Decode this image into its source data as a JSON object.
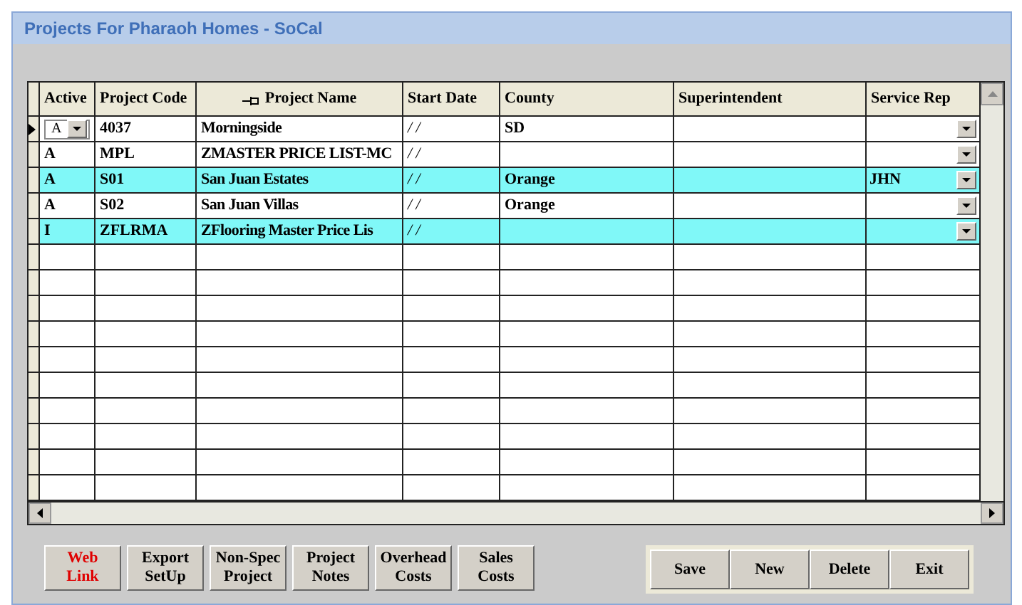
{
  "window": {
    "title": "Projects For Pharaoh Homes - SoCal"
  },
  "table": {
    "columns": [
      "Active",
      "Project Code",
      "Project Name",
      "Start Date",
      "County",
      "Superintendent",
      "Service Rep"
    ],
    "rows": [
      {
        "active": "A",
        "code": "4037",
        "name": "Morningside",
        "start_date": "/ /",
        "county": "SD",
        "service_rep": "",
        "current": true,
        "highlighted": false
      },
      {
        "active": "A",
        "code": "MPL",
        "name": "ZMASTER PRICE LIST-MC",
        "start_date": "/ /",
        "county": "",
        "service_rep": "",
        "current": false,
        "highlighted": false
      },
      {
        "active": "A",
        "code": "S01",
        "name": "San Juan Estates",
        "start_date": "/ /",
        "county": "Orange",
        "service_rep": "JHN",
        "current": false,
        "highlighted": true
      },
      {
        "active": "A",
        "code": "S02",
        "name": "San Juan Villas",
        "start_date": "/ /",
        "county": "Orange",
        "service_rep": "",
        "current": false,
        "highlighted": false
      },
      {
        "active": "I",
        "code": "ZFLRMA",
        "name": "ZFlooring Master Price Lis",
        "start_date": "/ /",
        "county": "",
        "service_rep": "",
        "current": false,
        "highlighted": true
      }
    ]
  },
  "left_buttons": [
    {
      "lines": [
        "Web",
        "Link"
      ],
      "color": "#e00000"
    },
    {
      "lines": [
        "Export",
        "SetUp"
      ],
      "color": "#000000"
    },
    {
      "lines": [
        "Non-Spec",
        "Project"
      ],
      "color": "#000000"
    },
    {
      "lines": [
        "Project",
        "Notes"
      ],
      "color": "#000000"
    },
    {
      "lines": [
        "Overhead",
        "Costs"
      ],
      "color": "#000000"
    },
    {
      "lines": [
        "Sales",
        "Costs"
      ],
      "color": "#000000"
    }
  ],
  "right_buttons": [
    "Save",
    "New",
    "Delete",
    "Exit"
  ]
}
